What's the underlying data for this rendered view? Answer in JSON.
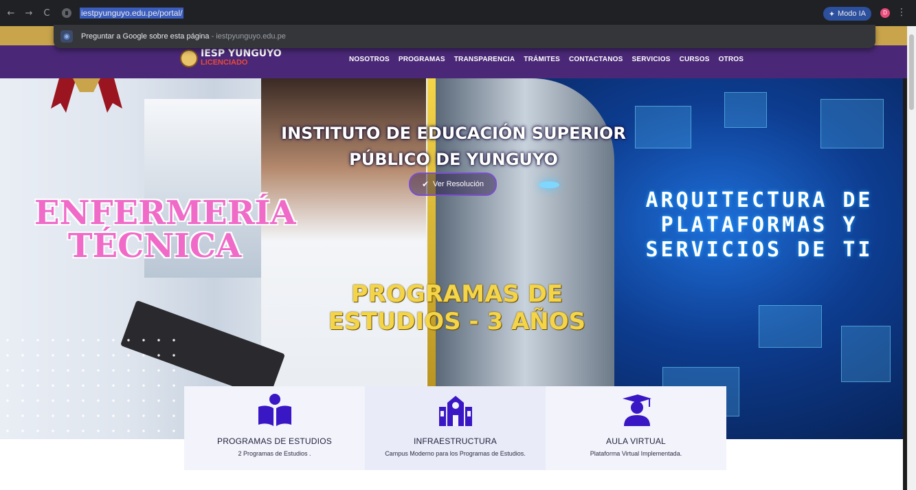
{
  "browser": {
    "nav": {
      "back_icon": "←",
      "forward_icon": "→",
      "reload_icon": "C"
    },
    "url": "iestpyunguyo.edu.pe/portal/",
    "ai_button": "Modo IA",
    "profile_initial": "D",
    "suggestion": {
      "text": "Preguntar a Google sobre esta página",
      "separator": " - ",
      "domain": "iestpyunguyo.edu.pe"
    }
  },
  "site": {
    "logo": {
      "line1": "IESP YUNGUYO",
      "line2": "LICENCIADO"
    },
    "menu": [
      "NOSOTROS",
      "PROGRAMAS",
      "TRANSPARENCIA",
      "TRÁMITES",
      "CONTACTANOS",
      "SERVICIOS",
      "CURSOS",
      "OTROS"
    ],
    "colors": {
      "header": "#4a2877",
      "accent": "#f4d548",
      "card_icon": "#3a17c4"
    }
  },
  "hero": {
    "title_line1": "INSTITUTO DE EDUCACIÓN SUPERIOR",
    "title_line2": "PÚBLICO DE YUNGUYO",
    "resolution_button": "Ver Resolución",
    "left_program_line1": "ENFERMERÍA",
    "left_program_line2": "TÉCNICA",
    "right_program_line1": "ARQUITECTURA DE",
    "right_program_line2": "PLATAFORMAS Y",
    "right_program_line3": "SERVICIOS DE TI",
    "duration_text": "PROGRAMAS DE ESTUDIOS - 3 AÑOS"
  },
  "features": [
    {
      "icon": "book-reader-icon",
      "title": "PROGRAMAS DE ESTUDIOS",
      "desc": "2 Programas de Estudios ."
    },
    {
      "icon": "school-building-icon",
      "title": "INFRAESTRUCTURA",
      "desc": "Campus Moderno para los Programas de Estudios."
    },
    {
      "icon": "graduate-icon",
      "title": "AULA VIRTUAL",
      "desc": "Plataforma Virtual Implementada."
    }
  ]
}
